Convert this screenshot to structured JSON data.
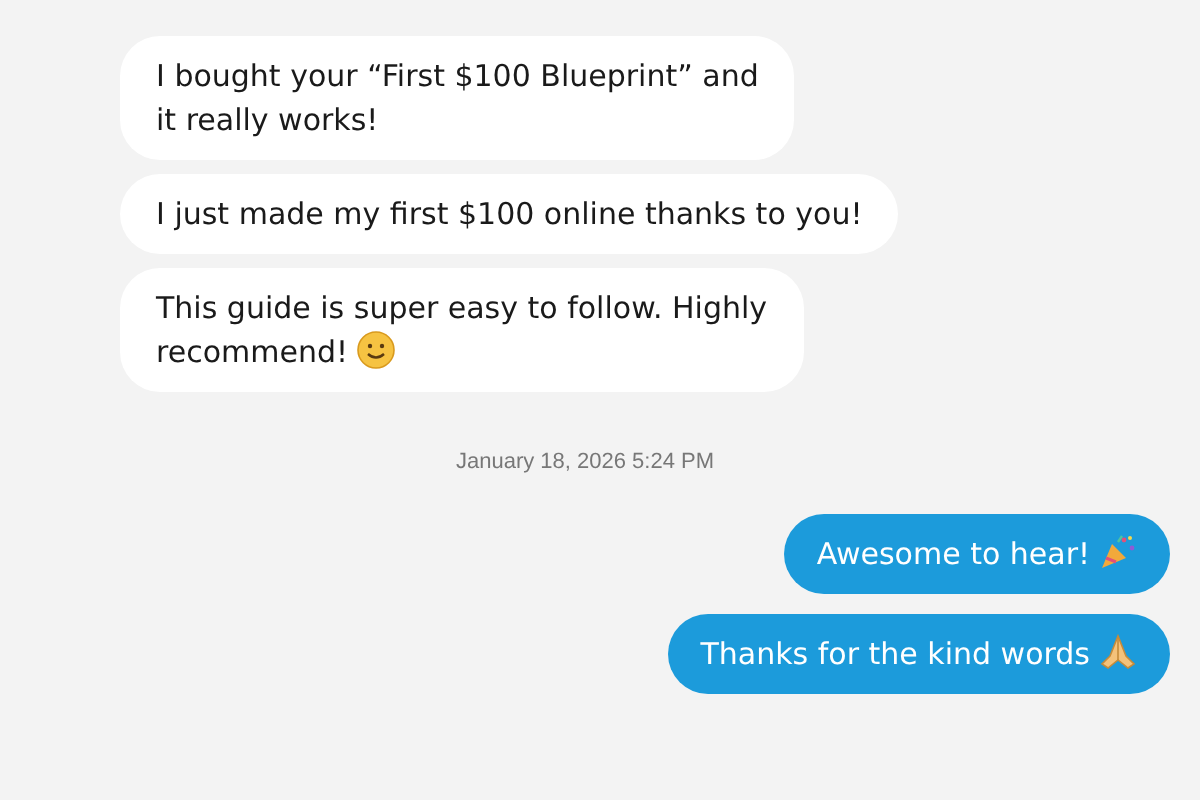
{
  "messages_before": [
    {
      "kind": "incoming",
      "text": "I bought your “First $100 Blueprint” and\nit really works!"
    },
    {
      "kind": "incoming",
      "text": "I just made my first $100 online thanks to you!"
    },
    {
      "kind": "incoming",
      "text": "This guide is super easy to follow. Highly\nrecommend!",
      "icons": [
        {
          "kind": "smiley"
        }
      ]
    }
  ],
  "timestamp": "January 18, 2026 5:24 PM",
  "messages_after": [
    {
      "kind": "outgoing",
      "text": "Awesome to hear!",
      "icons": [
        {
          "kind": "party"
        }
      ]
    },
    {
      "kind": "outgoing",
      "text": "Thanks for the kind words",
      "icons": [
        {
          "kind": "pray"
        }
      ]
    }
  ]
}
